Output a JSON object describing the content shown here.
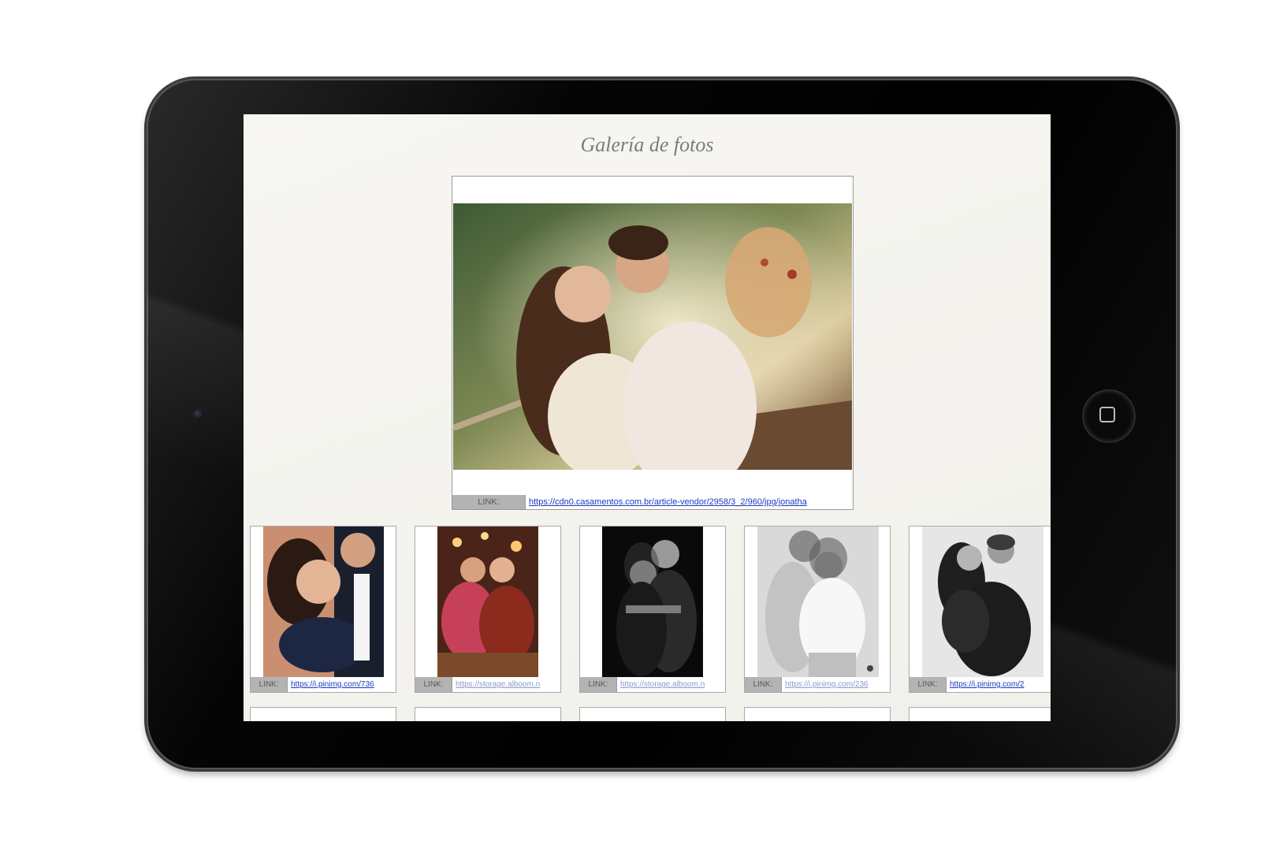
{
  "page": {
    "title": "Galería de fotos"
  },
  "main_photo": {
    "link_label": "LINK:",
    "link_url": "https://cdn0.casamentos.com.br/article-vendor/2958/3_2/960/jpg/jonatha"
  },
  "thumbnails": [
    {
      "link_label": "LINK:",
      "link_url": "https://i.pinimg.com/736"
    },
    {
      "link_label": "LINK:",
      "link_url": "https://storage.alboom.n"
    },
    {
      "link_label": "LINK:",
      "link_url": "https://storage.alboom.n"
    },
    {
      "link_label": "LINK:",
      "link_url": "https://i.pinimg.com/236"
    },
    {
      "link_label": "LINK:",
      "link_url": "https://i.pinimg.com/2"
    }
  ],
  "device": {
    "home_button_icon": "square-icon",
    "camera_icon": "camera-dot"
  }
}
